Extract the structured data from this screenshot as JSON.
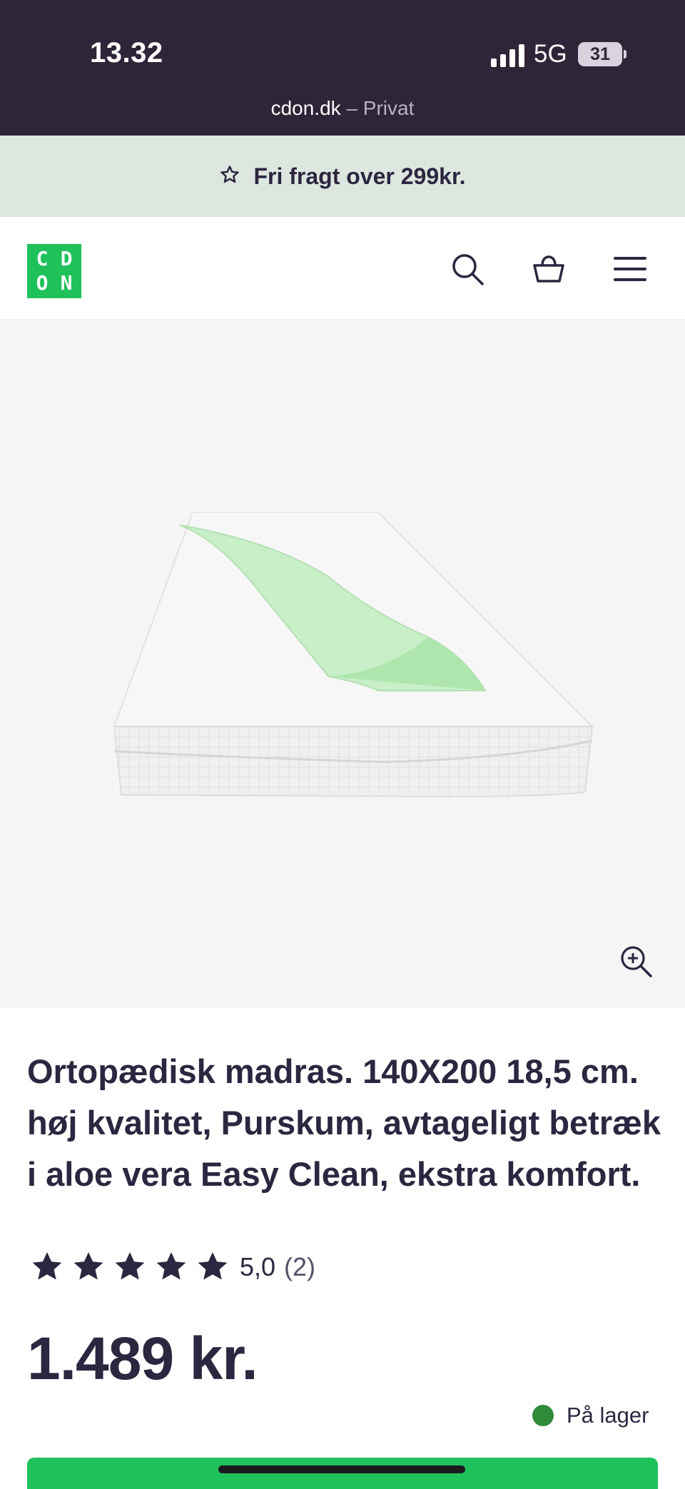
{
  "status_bar": {
    "time": "13.32",
    "network": "5G",
    "battery": "31"
  },
  "browser": {
    "domain": "cdon.dk",
    "mode": "– Privat"
  },
  "promo": {
    "text": "Fri fragt over 299kr.",
    "icon": "star-outline-icon"
  },
  "header": {
    "logo_letters": [
      "C",
      "D",
      "O",
      "N"
    ],
    "icons": [
      "search-icon",
      "cart-icon",
      "menu-icon"
    ]
  },
  "product": {
    "title": "Ortopædisk madras. 140X200 18,5 cm. høj kvalitet, Purskum, avtageligt be­træk i aloe vera Easy Clean, ekstra komfort.",
    "rating_value": "5,0",
    "rating_count": "(2)",
    "stars_filled": 5,
    "price": "1.489 kr.",
    "stock": "På lager"
  },
  "colors": {
    "status_bg": "#2e2538",
    "promo_bg": "#dde6df",
    "brand_green": "#1fc15b",
    "text_dark": "#2d2640",
    "stock_green": "#2f8a3a"
  }
}
